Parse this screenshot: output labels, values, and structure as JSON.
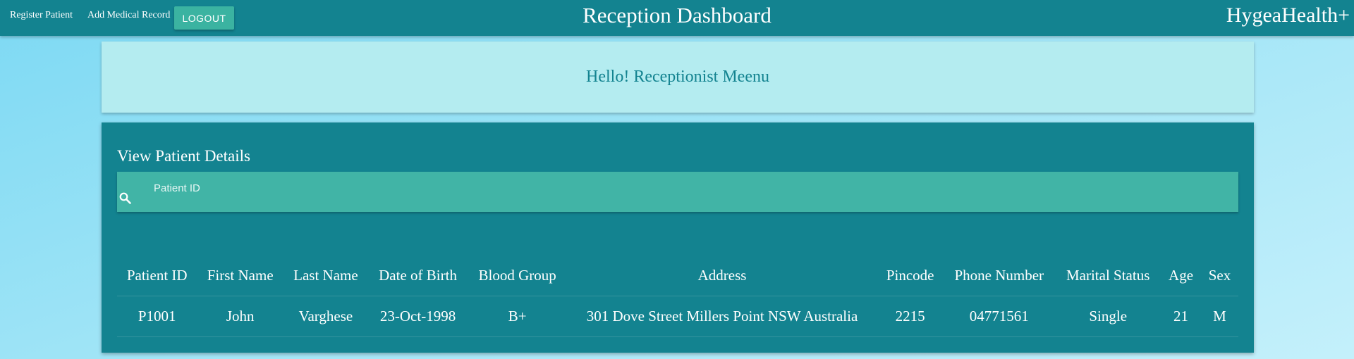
{
  "nav": {
    "register_patient": "Register Patient",
    "add_medical_record": "Add Medical Record",
    "logout": "LOGOUT",
    "title": "Reception Dashboard",
    "brand": "HygeaHealth+"
  },
  "greeting": {
    "text": "Hello! Receptionist Meenu"
  },
  "patient_details": {
    "title": "View Patient Details",
    "search_placeholder": "Patient ID",
    "search_icon": "search-icon",
    "columns": [
      "Patient ID",
      "First Name",
      "Last Name",
      "Date of Birth",
      "Blood Group",
      "Address",
      "Pincode",
      "Phone Number",
      "Marital Status",
      "Age",
      "Sex"
    ],
    "rows": [
      [
        "P1001",
        "John",
        "Varghese",
        "23-Oct-1998",
        "B+",
        "301 Dove Street Millers Point NSW Australia",
        "2215",
        "04771561",
        "Single",
        "21",
        "M"
      ]
    ]
  },
  "colors": {
    "primary": "#138390",
    "accent": "#3bb3a1",
    "search_bar": "#41b4a6",
    "greeting_bg": "#b4ecf0"
  }
}
